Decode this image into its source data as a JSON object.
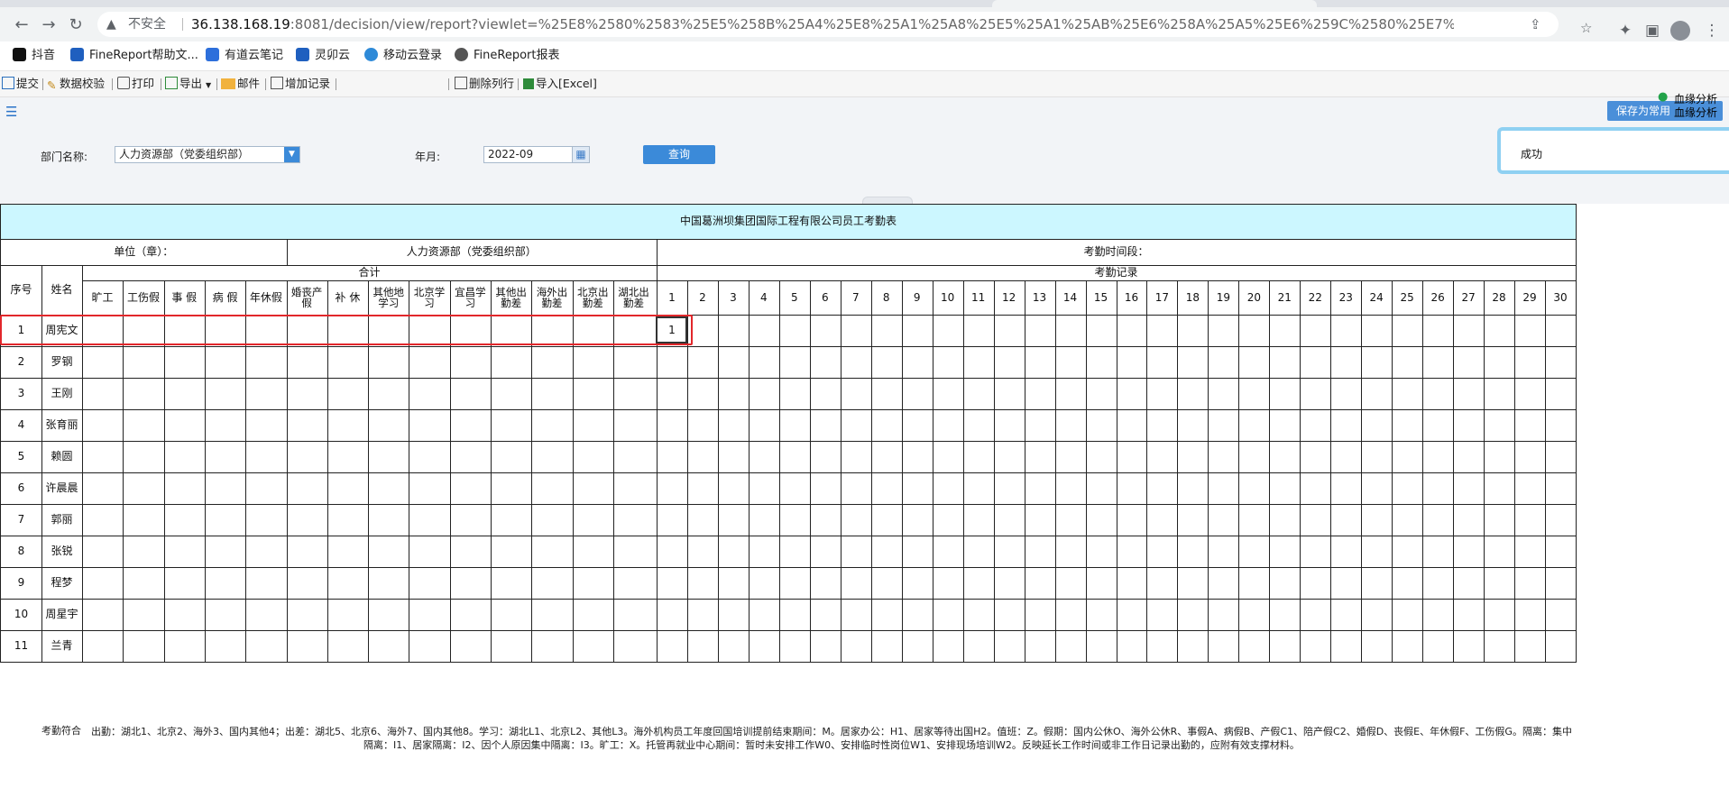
{
  "browser": {
    "insecure_label": "不安全",
    "url_host": "36.138.168.19",
    "url_path": ":8081/decision/view/report?viewlet=%25E8%2580%2583%25E5%258B%25A4%25E8%25A1%25A8%25E5%25A1%25AB%25E6%258A%25A5%25E6%259C%2580%25E7%25BB%2588%25E7%2589%2588%25E6%..."
  },
  "bookmarks": [
    {
      "label": "抖音",
      "color": "#111111"
    },
    {
      "label": "FineReport帮助文...",
      "color": "#1f5fbf"
    },
    {
      "label": "有道云笔记",
      "color": "#2d6fdb"
    },
    {
      "label": "灵卯云",
      "color": "#1f5fbf"
    },
    {
      "label": "移动云登录",
      "color": "#2e8ad8"
    },
    {
      "label": "FineReport报表",
      "color": "#555555"
    }
  ],
  "fr_toolbar": {
    "submit": "提交",
    "validate": "数据校验",
    "print": "打印",
    "export": "导出",
    "mail": "邮件",
    "add_record": "增加记录",
    "delete_row": "删除列行",
    "import_excel": "导入[Excel]",
    "save_as": "保存为常用",
    "blood_analysis": "血缘分析"
  },
  "params": {
    "dept_label": "部门名称:",
    "dept_value": "人力资源部（党委组织部）",
    "month_label": "年月:",
    "month_value": "2022-09",
    "query_label": "查询",
    "toast_text": "成功"
  },
  "report": {
    "title": "中国葛洲坝集团国际工程有限公司员工考勤表",
    "unit_label": "单位（章）：",
    "unit_value": "人力资源部（党委组织部）",
    "period_label": "考勤时间段：",
    "total_label": "合计",
    "record_label": "考勤记录",
    "seq_label": "序号",
    "name_label": "姓名",
    "summary_columns": [
      "旷工",
      "工伤假",
      "事 假",
      "病 假",
      "年休假",
      "婚丧产假",
      "补 休",
      "其他地学习",
      "北京学习",
      "宜昌学习",
      "其他出勤差",
      "海外出勤差",
      "北京出勤差",
      "湖北出勤差"
    ],
    "day_columns": [
      "1",
      "2",
      "3",
      "4",
      "5",
      "6",
      "7",
      "8",
      "9",
      "10",
      "11",
      "12",
      "13",
      "14",
      "15",
      "16",
      "17",
      "18",
      "19",
      "20",
      "21",
      "22",
      "23",
      "24",
      "25",
      "26",
      "27",
      "28",
      "29",
      "30"
    ],
    "rows": [
      {
        "seq": "1",
        "name": "周宪文",
        "day1": "1"
      },
      {
        "seq": "2",
        "name": "罗钢",
        "day1": ""
      },
      {
        "seq": "3",
        "name": "王刚",
        "day1": ""
      },
      {
        "seq": "4",
        "name": "张育丽",
        "day1": ""
      },
      {
        "seq": "5",
        "name": "赖圆",
        "day1": ""
      },
      {
        "seq": "6",
        "name": "许晨晨",
        "day1": ""
      },
      {
        "seq": "7",
        "name": "郭丽",
        "day1": ""
      },
      {
        "seq": "8",
        "name": "张锐",
        "day1": ""
      },
      {
        "seq": "9",
        "name": "程梦",
        "day1": ""
      },
      {
        "seq": "10",
        "name": "周星宇",
        "day1": ""
      },
      {
        "seq": "11",
        "name": "兰青",
        "day1": ""
      }
    ],
    "legend_label": "考勤符合",
    "legend_text": "出勤：湖北1、北京2、海外3、国内其他4；出差：湖北5、北京6、海外7、国内其他8。学习：湖北L1、北京L2、其他L3。海外机构员工年度回国培训提前结束期间：M。居家办公：H1、居家等待出国H2。值班：Z。假期：国内公休O、海外公休R、事假A、病假B、产假C1、陪产假C2、婚假D、丧假E、年休假F、工伤假G。隔离：集中隔离：I1、居家隔离：I2、因个人原因集中隔离：I3。旷工：X。托管再就业中心期间：暂时未安排工作W0、安排临时性岗位W1、安排现场培训W2。反映延长工作时间或非工作日记录出勤的，应附有效支撑材料。"
  }
}
